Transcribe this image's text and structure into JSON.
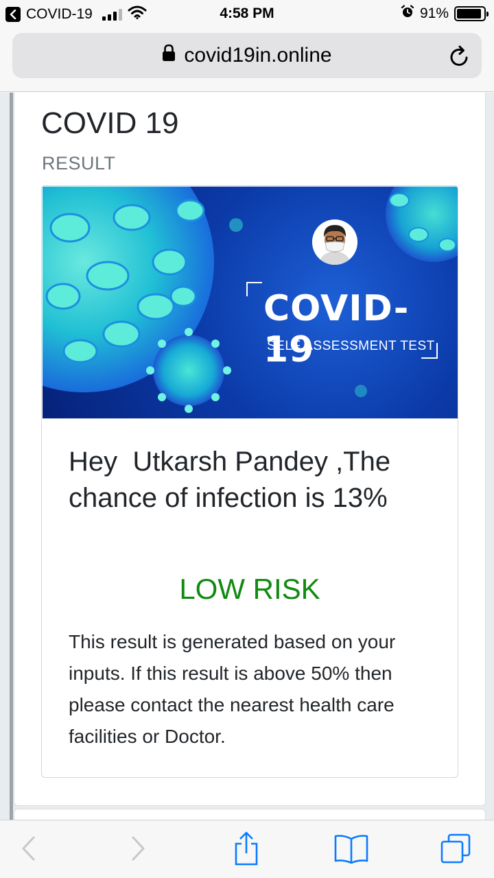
{
  "status_bar": {
    "back_app": "COVID-19",
    "time": "4:58 PM",
    "battery": "91%",
    "battery_level": 0.91
  },
  "browser": {
    "url": "covid19in.online"
  },
  "page": {
    "title": "COVID 19",
    "subtitle": "RESULT",
    "banner": {
      "title": "COVID-19",
      "subtitle": "SELF ASSESSMENT TEST"
    },
    "headline": "Hey  Utkarsh Pandey ,The chance of infection is 13%",
    "risk_label": "LOW RISK",
    "description": "This result is generated based on your inputs. If this result is above 50% then please contact the nearest health care facilities or Doctor."
  },
  "colors": {
    "risk": "#108a10",
    "accent": "#0a7aff",
    "banner": "#0b3aa8"
  },
  "icons": {
    "back": "chevron-left-icon",
    "forward": "chevron-right-icon",
    "share": "share-icon",
    "bookmarks": "book-icon",
    "tabs": "tabs-icon",
    "lock": "lock-icon",
    "reload": "reload-icon"
  }
}
